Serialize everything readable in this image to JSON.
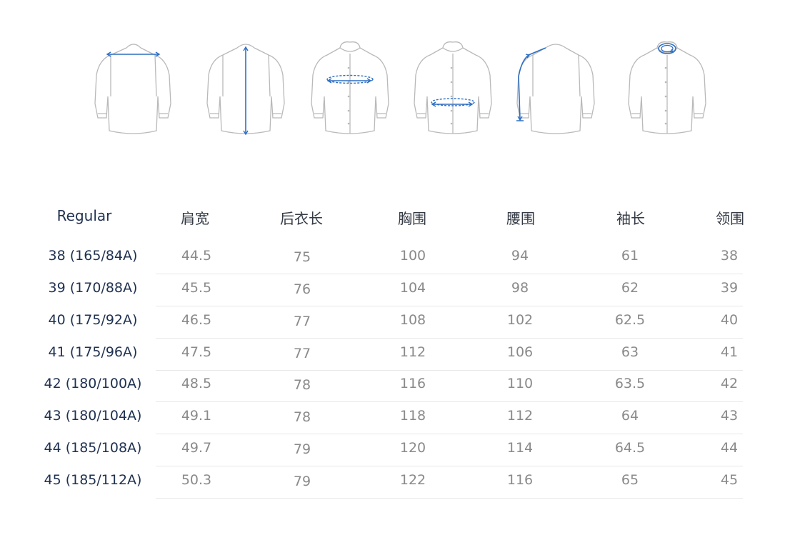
{
  "measurement_icons": [
    {
      "name": "shoulder-width-icon"
    },
    {
      "name": "back-length-icon"
    },
    {
      "name": "chest-icon"
    },
    {
      "name": "waist-icon"
    },
    {
      "name": "sleeve-length-icon"
    },
    {
      "name": "collar-icon"
    }
  ],
  "colors": {
    "accent": "#2d6fc4",
    "outline": "#b9b9b9",
    "label": "#1f3150",
    "value": "#8a8a8a"
  },
  "table": {
    "fit_label": "Regular",
    "headers": [
      "肩宽",
      "后衣长",
      "胸围",
      "腰围",
      "袖长",
      "领围"
    ],
    "rows": [
      {
        "size": "38 (165/84A)",
        "values": [
          "44.5",
          "75",
          "100",
          "94",
          "61",
          "38"
        ]
      },
      {
        "size": "39 (170/88A)",
        "values": [
          "45.5",
          "76",
          "104",
          "98",
          "62",
          "39"
        ]
      },
      {
        "size": "40 (175/92A)",
        "values": [
          "46.5",
          "77",
          "108",
          "102",
          "62.5",
          "40"
        ]
      },
      {
        "size": "41 (175/96A)",
        "values": [
          "47.5",
          "77",
          "112",
          "106",
          "63",
          "41"
        ]
      },
      {
        "size": "42 (180/100A)",
        "values": [
          "48.5",
          "78",
          "116",
          "110",
          "63.5",
          "42"
        ]
      },
      {
        "size": "43 (180/104A)",
        "values": [
          "49.1",
          "78",
          "118",
          "112",
          "64",
          "43"
        ]
      },
      {
        "size": "44 (185/108A)",
        "values": [
          "49.7",
          "79",
          "120",
          "114",
          "64.5",
          "44"
        ]
      },
      {
        "size": "45 (185/112A)",
        "values": [
          "50.3",
          "79",
          "122",
          "116",
          "65",
          "45"
        ]
      }
    ]
  }
}
